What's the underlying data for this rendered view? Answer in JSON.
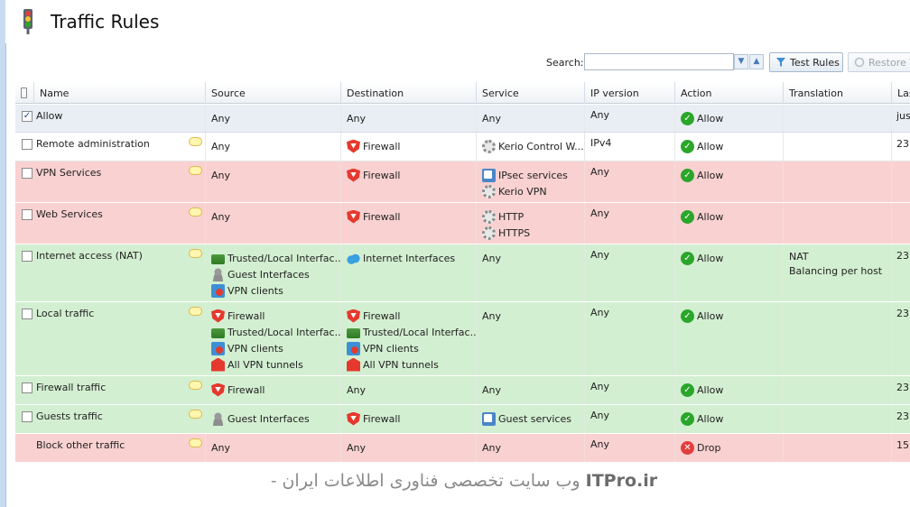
{
  "app": {
    "title": "Traffic Rules",
    "icon": "traffic-light-icon"
  },
  "toolbar": {
    "search_label": "Search:",
    "search_value": "",
    "test_rules_label": "Test Rules",
    "restore_label": "Restore Vi"
  },
  "columns": {
    "name": "Name",
    "source": "Source",
    "destination": "Destination",
    "service": "Service",
    "ip_version": "IP version",
    "action": "Action",
    "translation": "Translation",
    "last": "Las"
  },
  "rows": [
    {
      "status": "allow",
      "checked": true,
      "has_comment": false,
      "name": "Allow",
      "source": [
        {
          "label": "Any"
        }
      ],
      "destination": [
        {
          "label": "Any"
        }
      ],
      "service": [
        {
          "label": "Any"
        }
      ],
      "ip_version": "Any",
      "action": "Allow",
      "translation": [],
      "last": "just"
    },
    {
      "status": "plain",
      "checked": false,
      "has_comment": true,
      "name": "Remote administration",
      "source": [
        {
          "label": "Any"
        }
      ],
      "destination": [
        {
          "label": "Firewall",
          "icon": "firewall"
        }
      ],
      "service": [
        {
          "label": "Kerio Control W...",
          "icon": "gear"
        }
      ],
      "ip_version": "IPv4",
      "action": "Allow",
      "translation": [],
      "last": "23"
    },
    {
      "status": "deny",
      "checked": false,
      "has_comment": true,
      "name": "VPN Services",
      "source": [
        {
          "label": "Any"
        }
      ],
      "destination": [
        {
          "label": "Firewall",
          "icon": "firewall"
        }
      ],
      "service": [
        {
          "label": "IPsec services",
          "icon": "ipsec"
        },
        {
          "label": "Kerio VPN",
          "icon": "gear"
        }
      ],
      "ip_version": "Any",
      "action": "Allow",
      "translation": [],
      "last": ""
    },
    {
      "status": "deny",
      "checked": false,
      "has_comment": true,
      "name": "Web Services",
      "source": [
        {
          "label": "Any"
        }
      ],
      "destination": [
        {
          "label": "Firewall",
          "icon": "firewall"
        }
      ],
      "service": [
        {
          "label": "HTTP",
          "icon": "gear"
        },
        {
          "label": "HTTPS",
          "icon": "gear"
        }
      ],
      "ip_version": "Any",
      "action": "Allow",
      "translation": [],
      "last": ""
    },
    {
      "status": "allow",
      "checked": false,
      "has_comment": true,
      "name": "Internet access (NAT)",
      "source": [
        {
          "label": "Trusted/Local Interfac...",
          "icon": "trusted"
        },
        {
          "label": "Guest Interfaces",
          "icon": "guest"
        },
        {
          "label": "VPN clients",
          "icon": "vpn"
        }
      ],
      "destination": [
        {
          "label": "Internet Interfaces",
          "icon": "cloud"
        }
      ],
      "service": [
        {
          "label": "Any"
        }
      ],
      "ip_version": "Any",
      "action": "Allow",
      "translation": [
        "NAT",
        "Balancing per host"
      ],
      "last": "23"
    },
    {
      "status": "allow",
      "checked": false,
      "has_comment": true,
      "name": "Local traffic",
      "source": [
        {
          "label": "Firewall",
          "icon": "firewall"
        },
        {
          "label": "Trusted/Local Interfac...",
          "icon": "trusted"
        },
        {
          "label": "VPN clients",
          "icon": "vpn"
        },
        {
          "label": "All VPN tunnels",
          "icon": "tunnel"
        }
      ],
      "destination": [
        {
          "label": "Firewall",
          "icon": "firewall"
        },
        {
          "label": "Trusted/Local Interfac...",
          "icon": "trusted"
        },
        {
          "label": "VPN clients",
          "icon": "vpn"
        },
        {
          "label": "All VPN tunnels",
          "icon": "tunnel"
        }
      ],
      "service": [
        {
          "label": "Any"
        }
      ],
      "ip_version": "Any",
      "action": "Allow",
      "translation": [],
      "last": "23"
    },
    {
      "status": "allow",
      "checked": false,
      "has_comment": true,
      "name": "Firewall traffic",
      "source": [
        {
          "label": "Firewall",
          "icon": "firewall"
        }
      ],
      "destination": [
        {
          "label": "Any"
        }
      ],
      "service": [
        {
          "label": "Any"
        }
      ],
      "ip_version": "Any",
      "action": "Allow",
      "translation": [],
      "last": "23"
    },
    {
      "status": "allow",
      "checked": false,
      "has_comment": true,
      "name": "Guests traffic",
      "source": [
        {
          "label": "Guest Interfaces",
          "icon": "guest"
        }
      ],
      "destination": [
        {
          "label": "Firewall",
          "icon": "firewall"
        }
      ],
      "service": [
        {
          "label": "Guest services",
          "icon": "ipsec"
        }
      ],
      "ip_version": "Any",
      "action": "Allow",
      "translation": [],
      "last": "23"
    },
    {
      "status": "deny",
      "checked": null,
      "has_comment": true,
      "name": "Block other traffic",
      "source": [
        {
          "label": "Any"
        }
      ],
      "destination": [
        {
          "label": "Any"
        }
      ],
      "service": [
        {
          "label": "Any"
        }
      ],
      "ip_version": "Any",
      "action": "Drop",
      "translation": [],
      "last": "15"
    }
  ],
  "watermark": {
    "brand": "ITPro.ir",
    "text": "- وب سایت تخصصی فناوری اطلاعات ایران"
  },
  "colors": {
    "allow_row": "#d3efd1",
    "deny_row": "#f9d1d1",
    "allow_icon": "#2aa62a",
    "drop_icon": "#e33d3d",
    "frame": "#c7dcf2"
  }
}
